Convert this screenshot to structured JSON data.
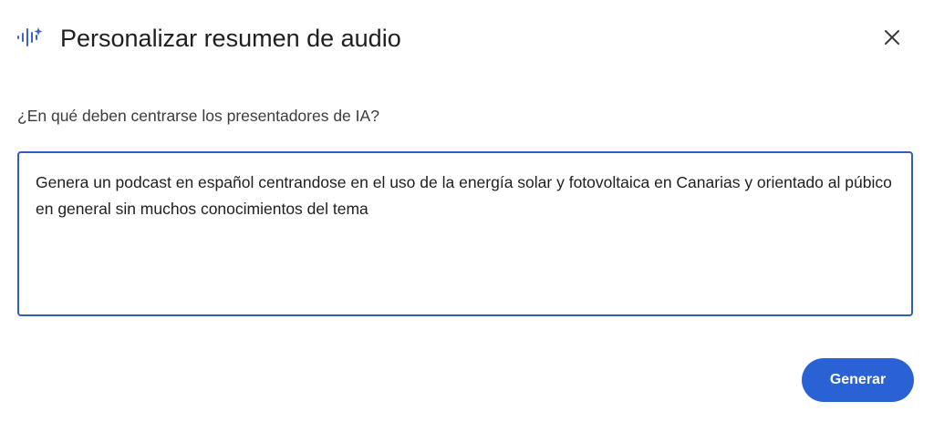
{
  "dialog": {
    "icon": "audio-spark-icon",
    "title": "Personalizar resumen de audio",
    "close_icon": "close-icon",
    "question": "¿En qué deben centrarse los presentadores de IA?",
    "prompt_value": "Genera un podcast en español centrandose en el uso de la energía solar y fotovoltaica en Canarias y orientado al púbico en general sin muchos conocimientos del tema",
    "generate_label": "Generar"
  },
  "colors": {
    "accent": "#2a62d6",
    "border_focus": "#2f5fc4",
    "icon": "#3d63c6"
  }
}
